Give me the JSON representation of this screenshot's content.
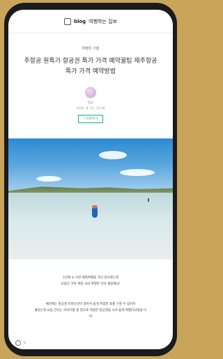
{
  "blog": {
    "logo_text": "blog",
    "name": "여행하는 집보"
  },
  "post": {
    "category": "여행의 기술",
    "title_line1": "주항공 원특가 항공권 특가 가격 예약꿀팁  제주항공",
    "title_line2": "특가 가격 예약방법",
    "author": "집보",
    "date": "2020. 8. 21. 15:44",
    "follow_label": "+ 이웃추가"
  },
  "caption": {
    "line1": "1년에 4~5번 해외여행을 가던 집보였는데",
    "line2": "요즘은 거의 여름 국내 여행만 다녀 힐링해요!"
  },
  "body": {
    "line1": "예전에는 항공권 프로모션이 많아서 쉽게 저렴한 표를 구할 수 있어서",
    "line2": "좋았는데 요즘 간다는 이야기를 할 정도로 저렴한 항공권을 사서 쉽게 여행다녀왔을 다",
    "line3": "며"
  },
  "footer": {
    "comment_count": "0"
  }
}
